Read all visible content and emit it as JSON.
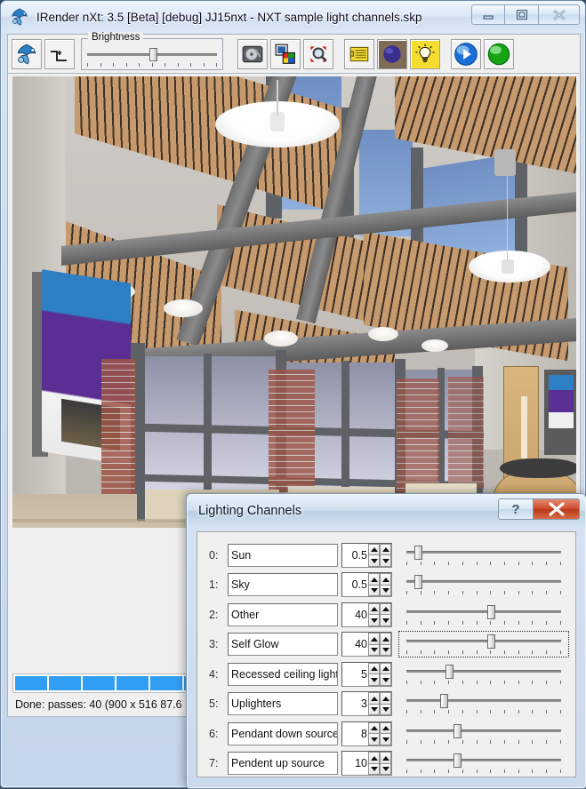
{
  "window": {
    "title": "IRender nXt: 3.5 [Beta] [debug] JJ15nxt - NXT sample light channels.skp",
    "icon": "irender-logo-icon",
    "buttons": {
      "minimize": "minimize-icon",
      "maximize": "maximize-icon",
      "close": "close-icon"
    }
  },
  "toolbar": {
    "brightness_label": "Brightness",
    "brightness_value": 52,
    "items": [
      {
        "name": "irender-logo-button",
        "icon": "irender-logo-icon"
      },
      {
        "name": "tone-curve-button",
        "icon": "step-curve-icon"
      },
      {
        "name": "save-to-disk-button",
        "icon": "hard-disk-icon"
      },
      {
        "name": "color-palette-button",
        "icon": "palette-icon"
      },
      {
        "name": "zoom-region-button",
        "icon": "magnifier-arrows-icon"
      },
      {
        "name": "notes-button",
        "icon": "yellow-notepad-icon"
      },
      {
        "name": "material-sphere-button",
        "icon": "blue-sphere-icon"
      },
      {
        "name": "lighting-button",
        "icon": "light-bulb-icon"
      },
      {
        "name": "play-render-button",
        "icon": "blue-play-icon"
      },
      {
        "name": "status-ok-button",
        "icon": "green-sphere-icon"
      }
    ]
  },
  "canvas": {
    "scroll_left_icon": "scroll-left-arrow-icon",
    "progress_segments": 17,
    "status_text": "Done: passes: 40 (900 x 516 87.6"
  },
  "dialog": {
    "title": "Lighting Channels",
    "help_label": "?",
    "close_label": "✕",
    "channels": [
      {
        "index": "0:",
        "name": "Sun",
        "value": "0.5",
        "slider": 7,
        "focused": false
      },
      {
        "index": "1:",
        "name": "Sky",
        "value": "0.5",
        "slider": 7,
        "focused": false
      },
      {
        "index": "2:",
        "name": "Other",
        "value": "40",
        "slider": 50,
        "focused": false
      },
      {
        "index": "3:",
        "name": "Self Glow",
        "value": "40",
        "slider": 50,
        "focused": true
      },
      {
        "index": "4:",
        "name": "Recessed ceiling lights",
        "value": "5",
        "slider": 25,
        "focused": false
      },
      {
        "index": "5:",
        "name": "Uplighters",
        "value": "3",
        "slider": 22,
        "focused": false
      },
      {
        "index": "6:",
        "name": "Pendant down source",
        "value": "8",
        "slider": 30,
        "focused": false
      },
      {
        "index": "7:",
        "name": "Pendent up source",
        "value": "10",
        "slider": 30,
        "focused": false
      }
    ],
    "spinner_up_icon": "spinner-up-arrow-icon",
    "spinner_down_icon": "spinner-down-arrow-icon"
  },
  "colors": {
    "accent_blue": "#2f9ef4",
    "aero_frame": "#cddcee",
    "close_red": "#cf4c2c",
    "dialog_body": "#f0f0f0"
  }
}
